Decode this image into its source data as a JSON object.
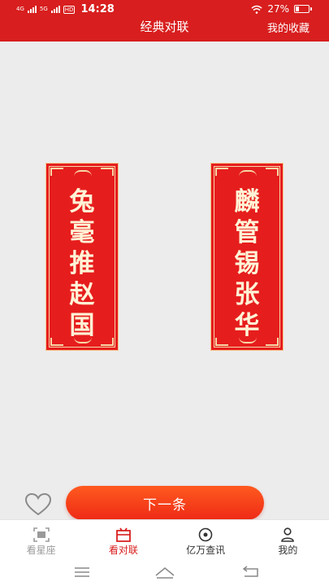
{
  "status": {
    "network_left": "4G",
    "network_right": "5G",
    "hd": "HD",
    "time": "14:28",
    "battery": "27%",
    "battery_level": 0.27
  },
  "header": {
    "title": "经典对联",
    "favorites_label": "我的收藏"
  },
  "couplets": {
    "left": [
      "兔",
      "毫",
      "推",
      "赵",
      "国"
    ],
    "right": [
      "麟",
      "管",
      "锡",
      "张",
      "华"
    ]
  },
  "actions": {
    "next_label": "下一条"
  },
  "tabs": [
    {
      "label": "看星座",
      "icon": "scan-icon"
    },
    {
      "label": "看对联",
      "icon": "couplet-icon"
    },
    {
      "label": "亿万查讯",
      "icon": "flower-icon"
    },
    {
      "label": "我的",
      "icon": "person-icon"
    }
  ],
  "colors": {
    "brand_red": "#d81e1e",
    "button_orange": "#ff5a1f",
    "couplet_gold": "#f7d6a6"
  }
}
